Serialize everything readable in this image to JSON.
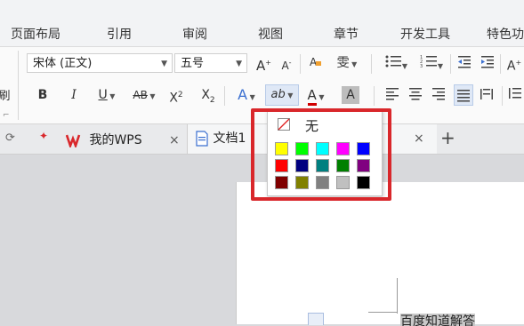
{
  "menu": {
    "items": [
      "页面布局",
      "引用",
      "审阅",
      "视图",
      "章节",
      "开发工具",
      "特色功"
    ]
  },
  "ribbon": {
    "font_name": "宋体 (正文)",
    "font_size": "五号",
    "left_cut_label": "刷",
    "bold": "B",
    "italic": "I",
    "underline": "U",
    "strike": "AB",
    "superscript_x": "X",
    "superscript_2": "2",
    "subscript_x": "X",
    "subscript_2": "2",
    "grow_font": "A",
    "shrink_font": "A",
    "text_effect": "A",
    "font_color": "A",
    "char_shading": "A",
    "highlight": "ab",
    "pinyin": "雯",
    "textbox_a": "A"
  },
  "tabs": {
    "wps_label": "我的WPS",
    "doc_label": "文档1",
    "close": "×",
    "add": "+"
  },
  "highlight_menu": {
    "none_label": "无",
    "colors": [
      "#ffff00",
      "#00ff00",
      "#00ffff",
      "#ff00ff",
      "#0000ff",
      "#ff0000",
      "#000080",
      "#008080",
      "#008000",
      "#800080",
      "#800000",
      "#808000",
      "#808080",
      "#c0c0c0",
      "#000000"
    ]
  },
  "document": {
    "text": "百度知道解答"
  }
}
